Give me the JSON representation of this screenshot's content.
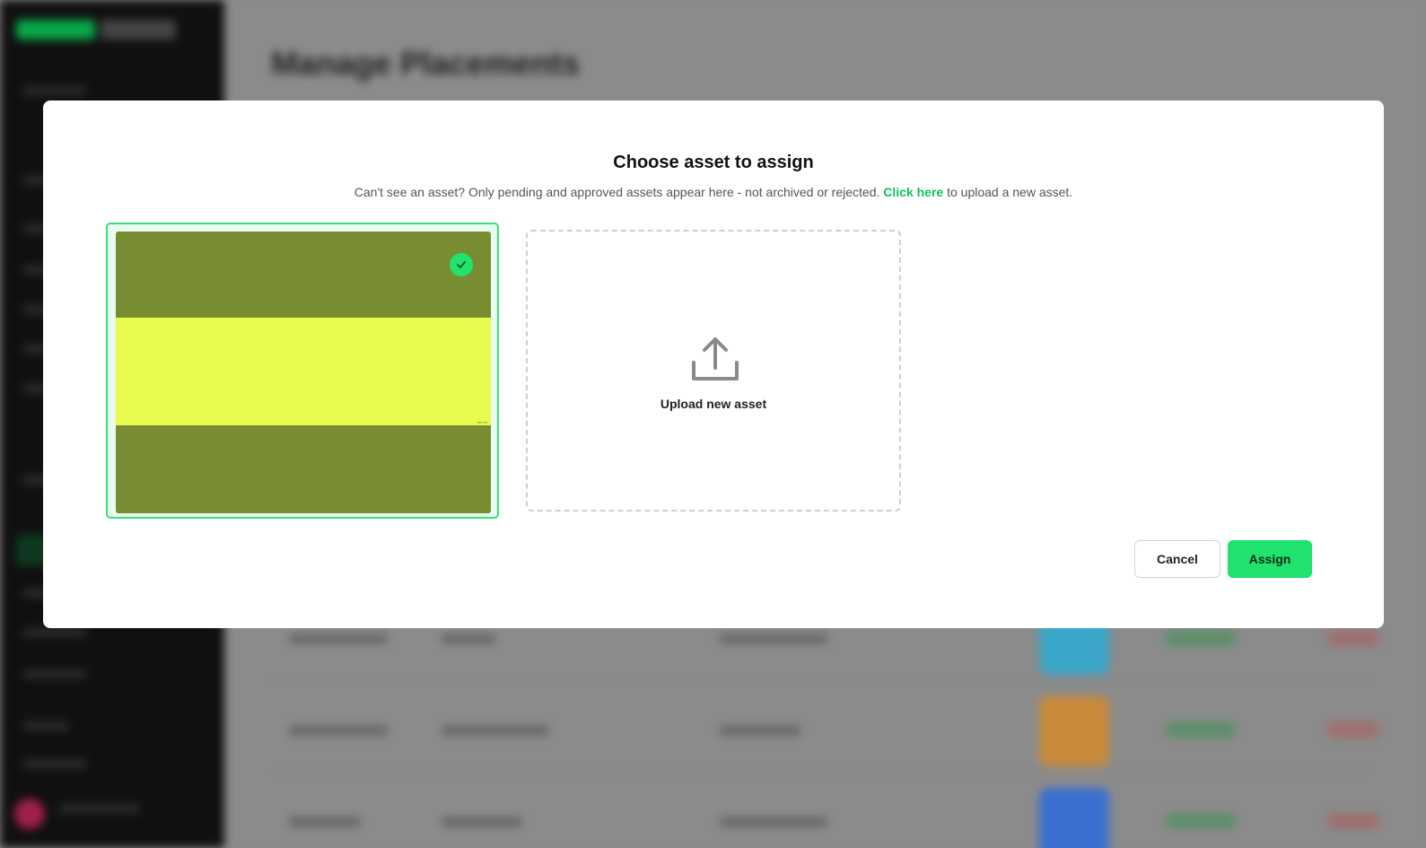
{
  "background_app": {
    "page_title": "Manage Placements",
    "swatch_colors": [
      "#3aa6c9",
      "#c98a3a",
      "#3a6fd1"
    ]
  },
  "modal": {
    "title": "Choose asset to assign",
    "subtitle_before_link": "Can't see an asset? Only pending and approved assets appear here - not archived or rejected.",
    "subtitle_link": "Click here",
    "subtitle_after_link": "to upload a new asset.",
    "selected_asset": {
      "selected": true,
      "check_icon": "check-icon",
      "colors": {
        "top": "#788c31",
        "band": "#e6fb4e",
        "bottom": "#788c31"
      }
    },
    "upload_card": {
      "icon": "upload-icon",
      "label": "Upload new asset"
    },
    "buttons": {
      "cancel_label": "Cancel",
      "assign_label": "Assign"
    }
  },
  "colors": {
    "accent": "#1fe26f",
    "link": "#11c25a"
  }
}
